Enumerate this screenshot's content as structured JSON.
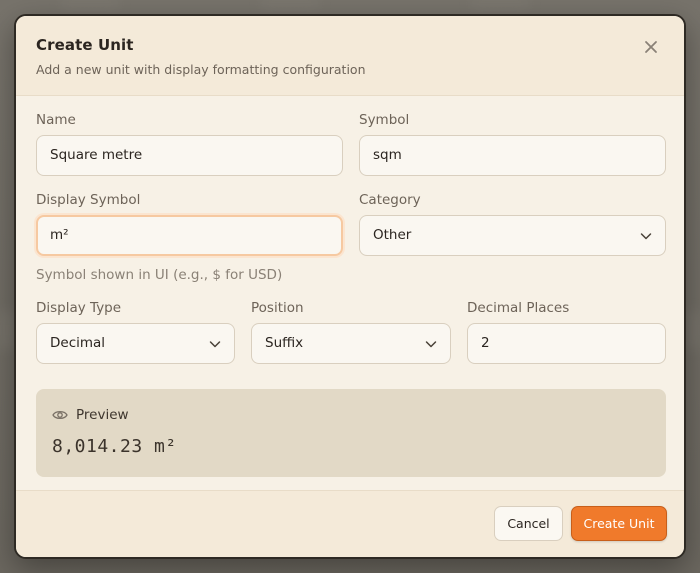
{
  "dialog": {
    "title": "Create Unit",
    "subtitle": "Add a new unit with display formatting configuration",
    "close_icon": "close-icon"
  },
  "form": {
    "name": {
      "label": "Name",
      "value": "Square metre"
    },
    "symbol": {
      "label": "Symbol",
      "value": "sqm"
    },
    "display_symbol": {
      "label": "Display Symbol",
      "value": "m²",
      "hint": "Symbol shown in UI (e.g., $ for USD)"
    },
    "category": {
      "label": "Category",
      "value": "Other"
    },
    "display_type": {
      "label": "Display Type",
      "value": "Decimal"
    },
    "position": {
      "label": "Position",
      "value": "Suffix"
    },
    "decimal_places": {
      "label": "Decimal Places",
      "value": "2"
    }
  },
  "preview": {
    "icon": "eye-icon",
    "label": "Preview",
    "value": "8,014.23 m²"
  },
  "footer": {
    "cancel_label": "Cancel",
    "create_label": "Create Unit"
  },
  "colors": {
    "accent": "#f07a2b",
    "surface": "#f7f1e6",
    "preview_bg": "#e2d9c6"
  }
}
